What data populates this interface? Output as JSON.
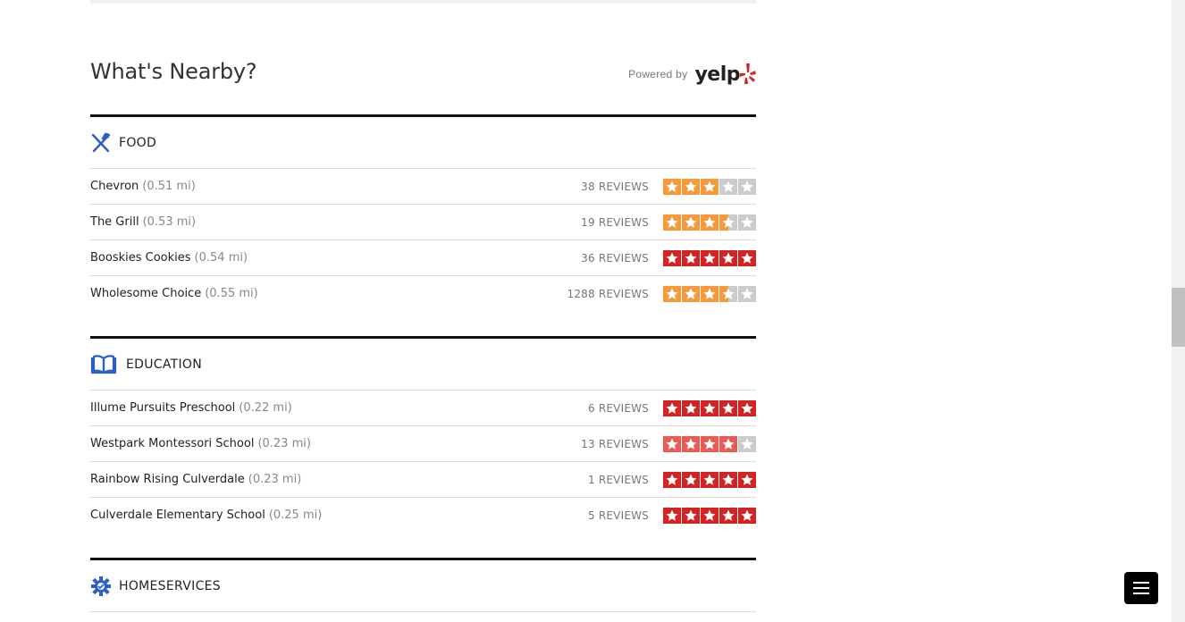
{
  "page_title": "What's Nearby?",
  "powered_by": "Powered by",
  "yelp_word": "yelp",
  "colors": {
    "orange": "#f5993b",
    "light_red": "#ea5b55",
    "red": "#d32323",
    "empty": "#cccccc",
    "icon_blue": "#2b5fc7"
  },
  "sections": [
    {
      "title": "FOOD",
      "icon": "fork-knife-icon",
      "items": [
        {
          "name": "Chevron",
          "distance": "(0.51 mi)",
          "reviews": "38 REVIEWS",
          "rating": 3
        },
        {
          "name": "The Grill",
          "distance": "(0.53 mi)",
          "reviews": "19 REVIEWS",
          "rating": 3.5
        },
        {
          "name": "Booskies Cookies",
          "distance": "(0.54 mi)",
          "reviews": "36 REVIEWS",
          "rating": 5
        },
        {
          "name": "Wholesome Choice",
          "distance": "(0.55 mi)",
          "reviews": "1288 REVIEWS",
          "rating": 3.5
        }
      ]
    },
    {
      "title": "EDUCATION",
      "icon": "book-icon",
      "items": [
        {
          "name": "Illume Pursuits Preschool",
          "distance": "(0.22 mi)",
          "reviews": "6 REVIEWS",
          "rating": 5
        },
        {
          "name": "Westpark Montessori School",
          "distance": "(0.23 mi)",
          "reviews": "13 REVIEWS",
          "rating": 4
        },
        {
          "name": "Rainbow Rising Culverdale",
          "distance": "(0.23 mi)",
          "reviews": "1 REVIEWS",
          "rating": 5
        },
        {
          "name": "Culverdale Elementary School",
          "distance": "(0.25 mi)",
          "reviews": "5 REVIEWS",
          "rating": 5
        }
      ]
    },
    {
      "title": "HOMESERVICES",
      "icon": "gear-icon",
      "items": []
    }
  ]
}
